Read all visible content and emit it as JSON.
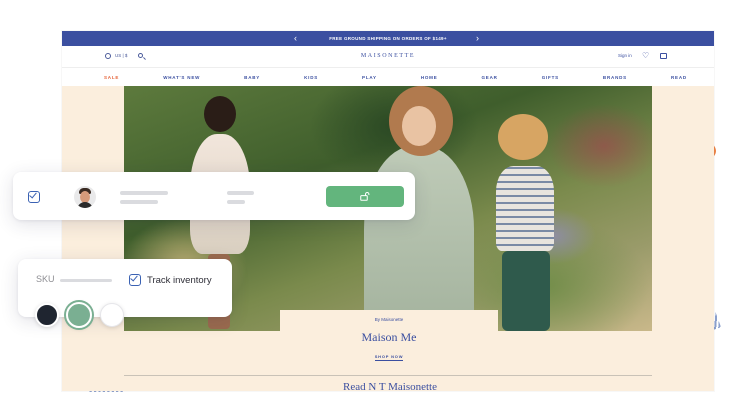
{
  "promo_bar": {
    "text": "FREE GROUND SHIPPING ON ORDERS OF $149+",
    "prev_icon": "chevron-left-icon",
    "next_icon": "chevron-right-icon",
    "prev_glyph": "‹",
    "next_glyph": "›"
  },
  "header": {
    "locale": "US | $",
    "logo": "MAISONETTE",
    "sign_in": "Sign in",
    "heart_glyph": "♡"
  },
  "nav": {
    "items": [
      {
        "label": "SALE"
      },
      {
        "label": "WHAT'S NEW"
      },
      {
        "label": "BABY"
      },
      {
        "label": "KIDS"
      },
      {
        "label": "PLAY"
      },
      {
        "label": "HOME"
      },
      {
        "label": "GEAR"
      },
      {
        "label": "GIFTS"
      },
      {
        "label": "BRANDS"
      },
      {
        "label": "READ"
      }
    ]
  },
  "hero": {
    "byline": "By Maisonette",
    "title": "Maison Me",
    "cta": "SHOP NOW"
  },
  "next_section_title": "Read N  T  Maisonette",
  "product_card": {
    "selected": true,
    "unlock_icon": "unlock-icon"
  },
  "inventory_card": {
    "sku_label": "SKU",
    "track_label": "Track inventory",
    "track_checked": true
  },
  "swatches": [
    {
      "name": "navy",
      "color": "#1f2530",
      "selected": false
    },
    {
      "name": "sage",
      "color": "#7aaf92",
      "selected": true
    },
    {
      "name": "white",
      "color": "#ffffff",
      "selected": false
    }
  ],
  "colors": {
    "brand_blue": "#3b4fa0",
    "sale_orange": "#e6643a",
    "success_green": "#63b57d",
    "checkbox_blue": "#3b62b3",
    "site_background": "#fbeedd"
  }
}
